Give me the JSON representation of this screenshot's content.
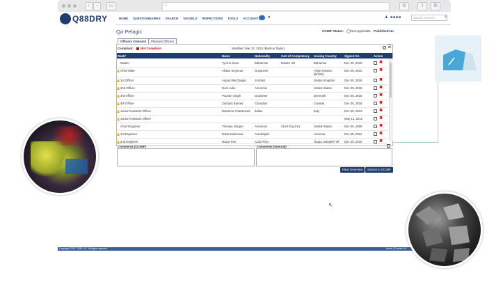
{
  "header": {
    "logo_text": "Q88DRY",
    "nav": [
      "HOME",
      "QUESTIONNAIRES",
      "SEARCH",
      "VESSELS",
      "INSPECTIONS",
      "TOOLS",
      "ACCOUNT"
    ],
    "search_placeholder": "Search Vessels"
  },
  "page": {
    "title": "Qa Pelagic",
    "ocimf_status_label": "OCIMF Status:",
    "ocimf_status_value": "Not Applicable",
    "published_label": "Published:",
    "published_value": "No"
  },
  "tabs": [
    {
      "label": "Officers Onboard",
      "active": true
    },
    {
      "label": "Planned Officers",
      "active": false
    }
  ],
  "meta": {
    "compliant_label": "Compliant:",
    "compliant_value": "Not Compliant",
    "modified": "Modified: Mar 12, 2013 (Marcus Taylor)"
  },
  "table": {
    "columns": [
      "Rank*",
      "Name",
      "Nationality",
      "Cert of Competency",
      "Issuing Country",
      "Signed On",
      "Action"
    ],
    "rows": [
      {
        "warn": false,
        "rank": "Master",
        "name": "Tyrone Dean",
        "nationality": "Bahamian",
        "cert": "Master II/2",
        "country": "Bahamas",
        "signed": "Dec 05, 2010"
      },
      {
        "warn": true,
        "rank": "Chief Mate",
        "name": "Afidan Seymour",
        "nationality": "Guyanese",
        "cert": "",
        "country": "Virgin Islands",
        "country2": "(British)",
        "signed": "Dec 05, 2010"
      },
      {
        "warn": true,
        "rank": "1st Officer",
        "name": "Angus MacGregor",
        "nationality": "Scottish",
        "cert": "",
        "country": "United Kingdom",
        "signed": "Dec 05, 2016"
      },
      {
        "warn": true,
        "rank": "2nd Officer",
        "name": "Nora Julia",
        "nationality": "American",
        "cert": "",
        "country": "United States",
        "signed": "Dec 05, 2015"
      },
      {
        "warn": true,
        "rank": "3rd Officer",
        "name": "Poonan Singh",
        "nationality": "Guinamer",
        "cert": "",
        "country": "Denmark",
        "signed": "Dec 05, 2016"
      },
      {
        "warn": true,
        "rank": "4th Officer",
        "name": "Zachary Barnes",
        "nationality": "Canadian",
        "cert": "",
        "country": "Canada",
        "signed": "Dec 05, 2016"
      },
      {
        "warn": true,
        "rank": "Junior/Assistant Officer",
        "name": "Massimo Charamede",
        "nationality": "Italian",
        "cert": "",
        "country": "Italy",
        "signed": "Dec 05, 2013"
      },
      {
        "warn": true,
        "rank": "Junior/Assistant Officer",
        "name": "",
        "nationality": "",
        "cert": "",
        "country": "",
        "signed": "May 12, 2012"
      },
      {
        "warn": false,
        "rank": "Chief Engineer",
        "name": "Thomas Norgan",
        "nationality": "American",
        "cert": "Chief Eng III/1",
        "country": "United States",
        "signed": "Dec 05, 2009"
      },
      {
        "warn": true,
        "rank": "1st Engineer",
        "name": "Musa Kazimova",
        "nationality": "Azerbaijani",
        "cert": "",
        "country": "Armenia",
        "signed": "Dec 05, 2011"
      },
      {
        "warn": true,
        "rank": "2nd Engineer",
        "name": "Nazar Fair",
        "nationality": "Cudo Rico",
        "cert": "",
        "country": "Taupa, Banglich Of",
        "signed": "Dec 05, 2016"
      }
    ]
  },
  "comments": {
    "ocimf_label": "Comments (OCIMF)",
    "internal_label": "Comments (Internal)"
  },
  "buttons": {
    "fleet_overview": "Fleet Overview",
    "submit": "Submit to OCIMF"
  },
  "footer": {
    "copyright": "Copyright ©2017 Q88 LLC. All rights reserved.",
    "links": "Home | Contact Us"
  },
  "colors": {
    "brand": "#1f3d6e",
    "link": "#2d4d82",
    "footer": "#3a5f95",
    "delete": "#cc1111",
    "warning": "#e8b000"
  }
}
